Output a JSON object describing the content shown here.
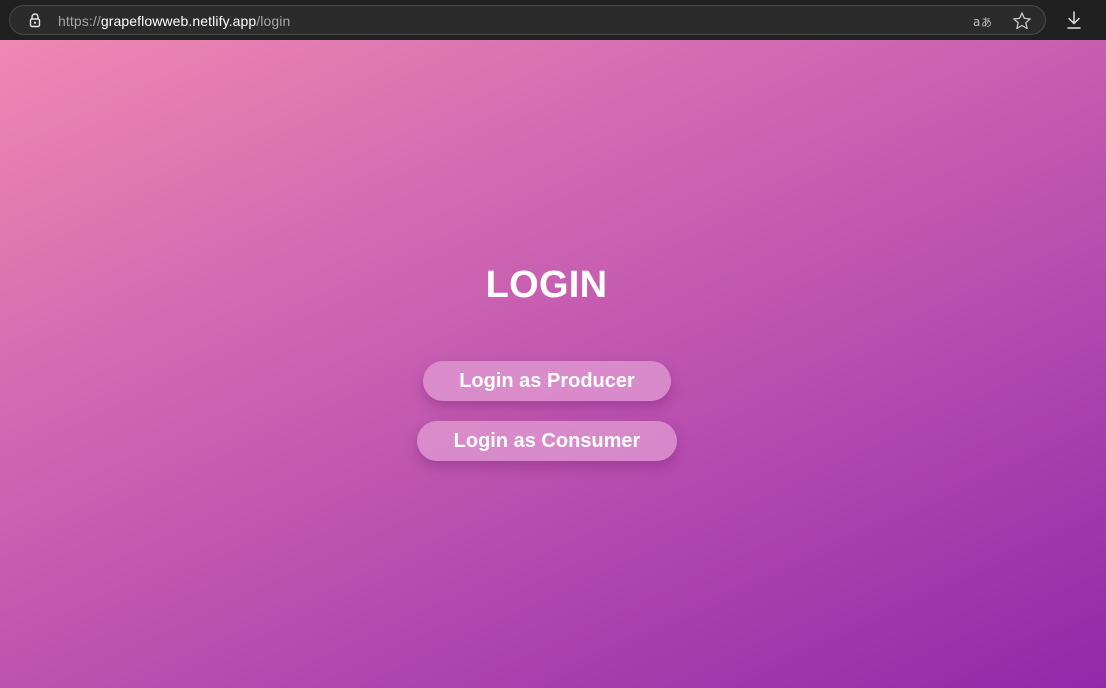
{
  "browser": {
    "url_scheme": "https://",
    "url_host": "grapeflowweb.netlify.app",
    "url_path": "/login",
    "icons": {
      "lock": "lock-icon",
      "translate": "translate-icon",
      "favorite": "star-icon",
      "downloads": "download-icon"
    }
  },
  "page": {
    "title": "LOGIN",
    "producer_button_label": "Login as Producer",
    "consumer_button_label": "Login as Consumer",
    "colors": {
      "gradient_start": "#ef88b2",
      "gradient_end": "#9328aa",
      "button_fill": "#e2a0d4",
      "text": "#ffffff"
    }
  }
}
